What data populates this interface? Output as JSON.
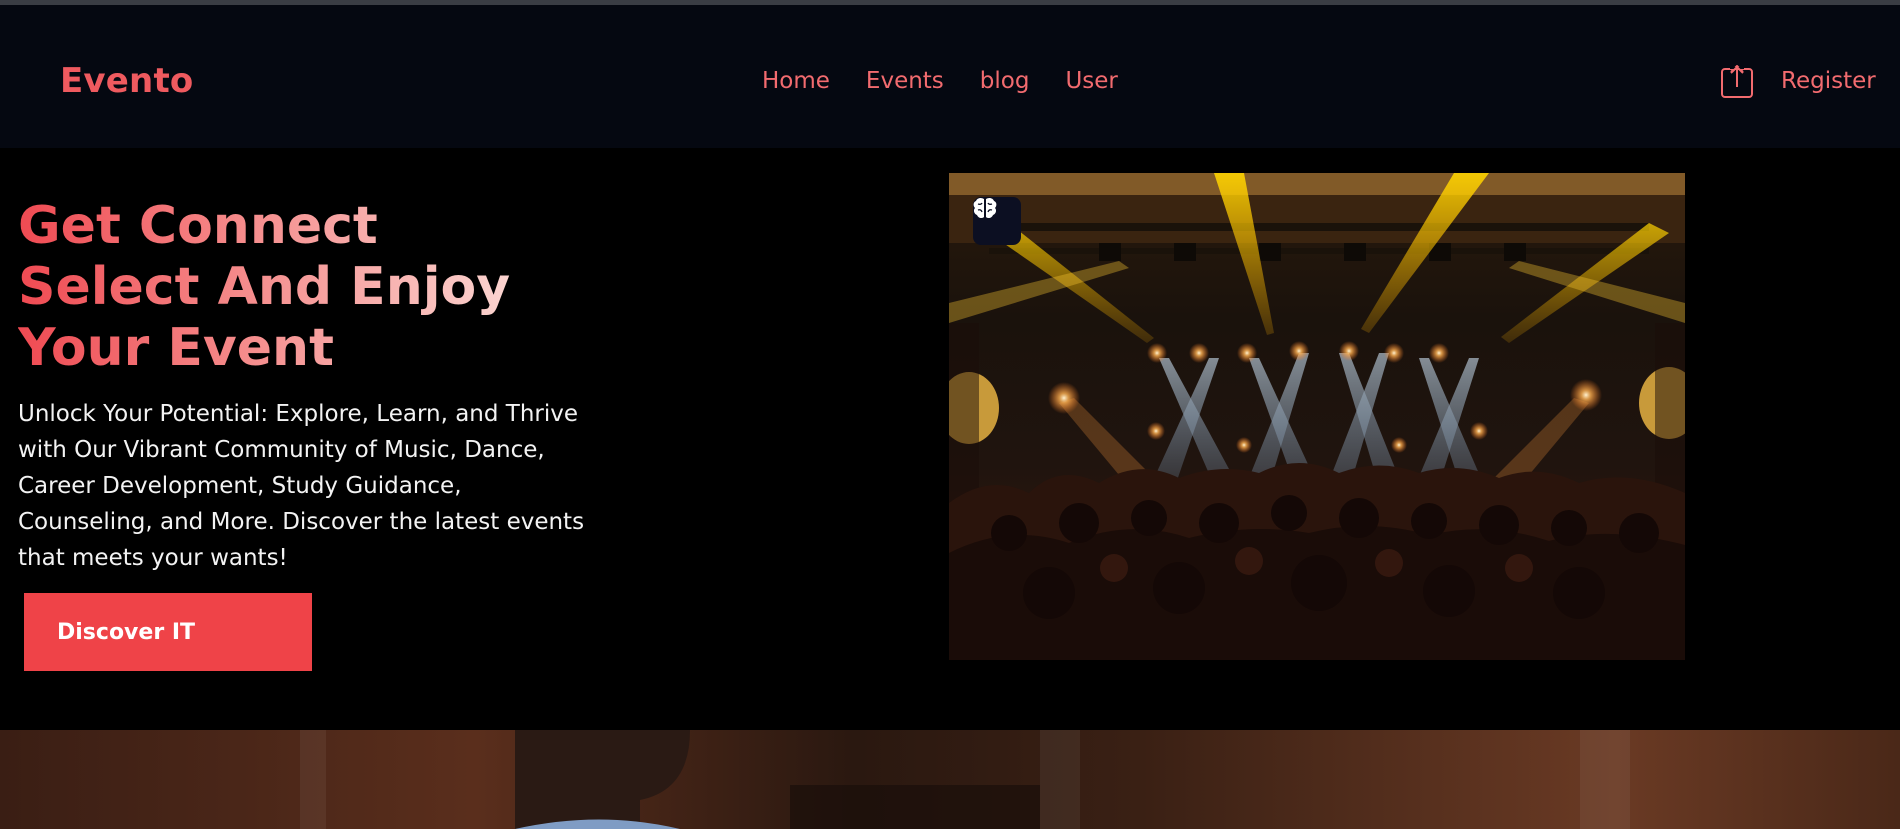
{
  "navbar": {
    "brand": "Evento",
    "links": [
      "Home",
      "Events",
      "blog",
      "User"
    ],
    "register_label": "Register",
    "accent_color": "#f26b6f"
  },
  "hero": {
    "headline_lines": [
      "Get Connect",
      "Select And Enjoy",
      "Your Event"
    ],
    "description": "Unlock Your Potential: Explore, Learn, and Thrive with Our Vibrant Community of Music, Dance, Career Development, Study Guidance, Counseling, and More. Discover the latest events that meets your wants!",
    "cta_label": "Discover IT",
    "cta_color": "#ef4348"
  },
  "icons": {
    "share": "share-upload-icon",
    "badge": "brain-icon"
  }
}
